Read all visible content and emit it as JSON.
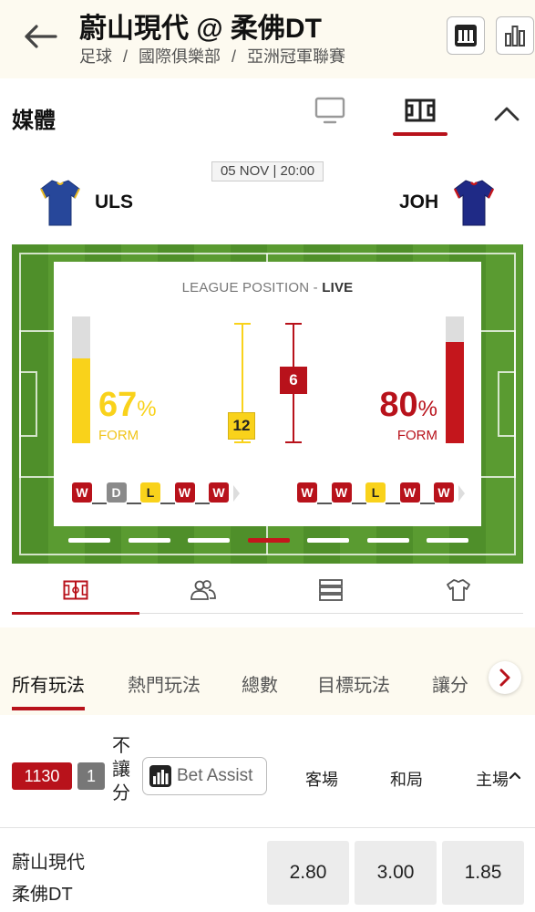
{
  "header": {
    "title": "蔚山現代 @ 柔佛DT",
    "breadcrumb": [
      "足球",
      "國際俱樂部",
      "亞洲冠軍聯賽"
    ],
    "breadcrumb_sep": "/"
  },
  "media": {
    "title": "媒體",
    "tabs": [
      "tv-icon",
      "pitch-icon"
    ],
    "active_tab": "pitch-icon"
  },
  "match": {
    "datetime": "05 NOV | 20:00",
    "home": {
      "code": "ULS"
    },
    "away": {
      "code": "JOH"
    }
  },
  "stats": {
    "title_prefix": "LEAGUE POSITION - ",
    "title_live": "LIVE",
    "home": {
      "form_value": "67",
      "form_unit": "%",
      "form_label": "FORM",
      "form_fraction": 0.67,
      "position": "12",
      "results": [
        "W",
        "D",
        "L",
        "W",
        "W"
      ]
    },
    "away": {
      "form_value": "80",
      "form_unit": "%",
      "form_label": "FORM",
      "form_fraction": 0.8,
      "position": "6",
      "results": [
        "W",
        "W",
        "L",
        "W",
        "W"
      ]
    },
    "pager_count": 7,
    "pager_active": 3
  },
  "sub_tabs": [
    "pitch-icon",
    "lineup-icon",
    "list-icon",
    "jersey-icon"
  ],
  "markets": {
    "tabs": [
      "所有玩法",
      "熱門玩法",
      "總數",
      "目標玩法",
      "讓分"
    ],
    "active": 0
  },
  "bet": {
    "market_id": "1130",
    "count": "1",
    "market_label_chars": [
      "不",
      "讓",
      "分"
    ],
    "assist_label": "Bet Assist",
    "columns": [
      "客場",
      "和局",
      "主場"
    ],
    "teams": [
      "蔚山現代",
      "柔佛DT"
    ],
    "odds": [
      "2.80",
      "3.00",
      "1.85"
    ]
  },
  "colors": {
    "accent_red": "#b8121b",
    "form_yellow": "#f9d21b",
    "draw_grey": "#8a8a8a",
    "header_bg": "#fdfaf0"
  }
}
